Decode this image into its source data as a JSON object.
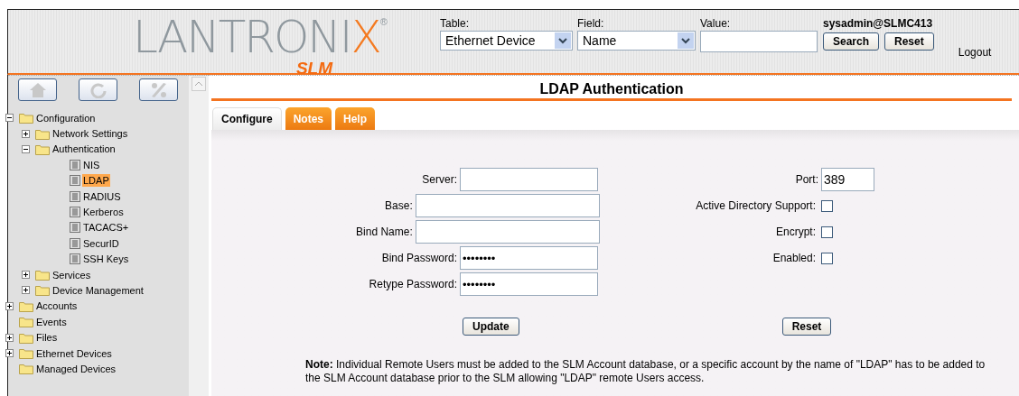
{
  "logo": {
    "text": "LANTRONIX",
    "mark": "®",
    "product": "SLM"
  },
  "search": {
    "table": {
      "label": "Table:",
      "value": "Ethernet Device"
    },
    "field": {
      "label": "Field:",
      "value": "Name"
    },
    "value": {
      "label": "Value:"
    },
    "user": "sysadmin@SLMC413",
    "buttons": [
      "Search",
      "Reset"
    ],
    "logout": "Logout"
  },
  "tree": [
    {
      "label": "Configuration",
      "kind": "folder",
      "expanded": true,
      "children": [
        {
          "label": "Network Settings",
          "kind": "folder",
          "expanded": false
        },
        {
          "label": "Authentication",
          "kind": "folder",
          "expanded": true,
          "children": [
            {
              "label": "NIS",
              "kind": "page",
              "selected": false
            },
            {
              "label": "LDAP",
              "kind": "page",
              "selected": true
            },
            {
              "label": "RADIUS",
              "kind": "page",
              "selected": false
            },
            {
              "label": "Kerberos",
              "kind": "page",
              "selected": false
            },
            {
              "label": "TACACS+",
              "kind": "page",
              "selected": false
            },
            {
              "label": "SecurID",
              "kind": "page",
              "selected": false
            },
            {
              "label": "SSH Keys",
              "kind": "page",
              "selected": false
            }
          ]
        },
        {
          "label": "Services",
          "kind": "folder",
          "expanded": false
        },
        {
          "label": "Device Management",
          "kind": "folder",
          "expanded": false
        }
      ]
    },
    {
      "label": "Accounts",
      "kind": "folder",
      "expanded": false
    },
    {
      "label": "Events",
      "kind": "leaf-folder"
    },
    {
      "label": "Files",
      "kind": "folder",
      "expanded": false
    },
    {
      "label": "Ethernet Devices",
      "kind": "folder",
      "expanded": false
    },
    {
      "label": "Managed Devices",
      "kind": "leaf-folder"
    }
  ],
  "page_title": "LDAP Authentication",
  "tabs": [
    {
      "label": "Configure",
      "selected": true
    },
    {
      "label": "Notes",
      "selected": false
    },
    {
      "label": "Help",
      "selected": false
    }
  ],
  "fields": [
    {
      "label": "Server:",
      "kind": "short"
    },
    {
      "label": "Base:",
      "kind": "long"
    },
    {
      "label": "Bind Name:",
      "kind": "long"
    },
    {
      "label": "Bind Password:",
      "kind": "short",
      "value": "••••••••"
    },
    {
      "label": "Retype Password:",
      "kind": "short",
      "value": "••••••••"
    }
  ],
  "port": {
    "label": "Port:",
    "value": "389"
  },
  "options": [
    {
      "label": "Active Directory Support:",
      "checked": false
    },
    {
      "label": "Encrypt:",
      "checked": false
    },
    {
      "label": "Enabled:",
      "checked": false
    }
  ],
  "actions": [
    "Update",
    "Reset"
  ],
  "note": "**Note:** Individual Remote Users must be added to the SLM Account database, or a specific account by the name of \"LDAP\" has to be added to the SLM Account database prior to the SLM allowing \"LDAP\" remote Users access."
}
